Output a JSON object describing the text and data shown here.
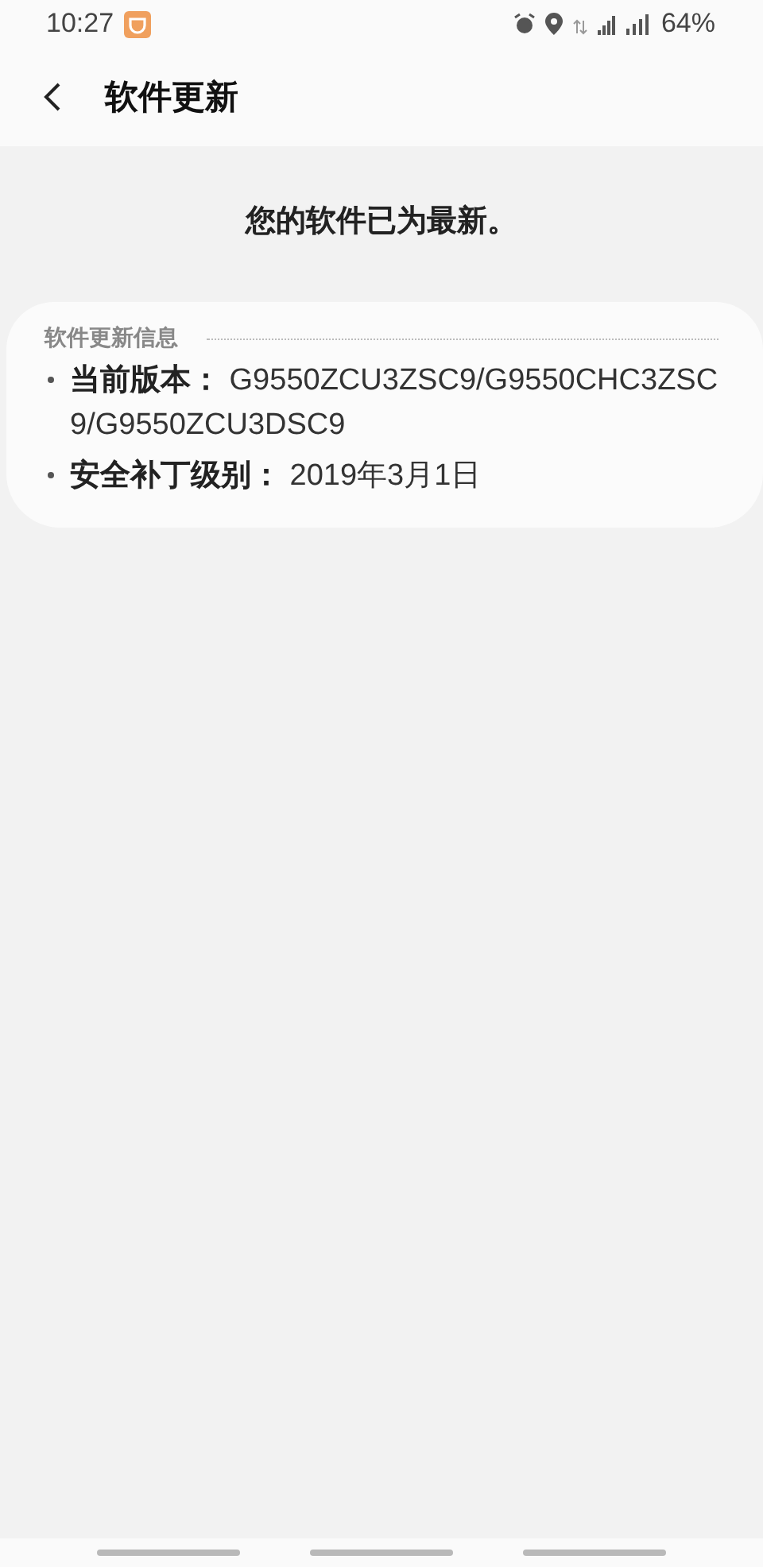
{
  "status_bar": {
    "time": "10:27",
    "battery": "64%"
  },
  "header": {
    "title": "软件更新"
  },
  "status_message": "您的软件已为最新。",
  "info_card": {
    "title": "软件更新信息",
    "items": [
      "**当前版本：** G9550ZCU3ZSC9/G9550CHC3ZSC9/G9550ZCU3DSC9",
      "**安全补丁级别：** 2019年3月1日"
    ]
  }
}
